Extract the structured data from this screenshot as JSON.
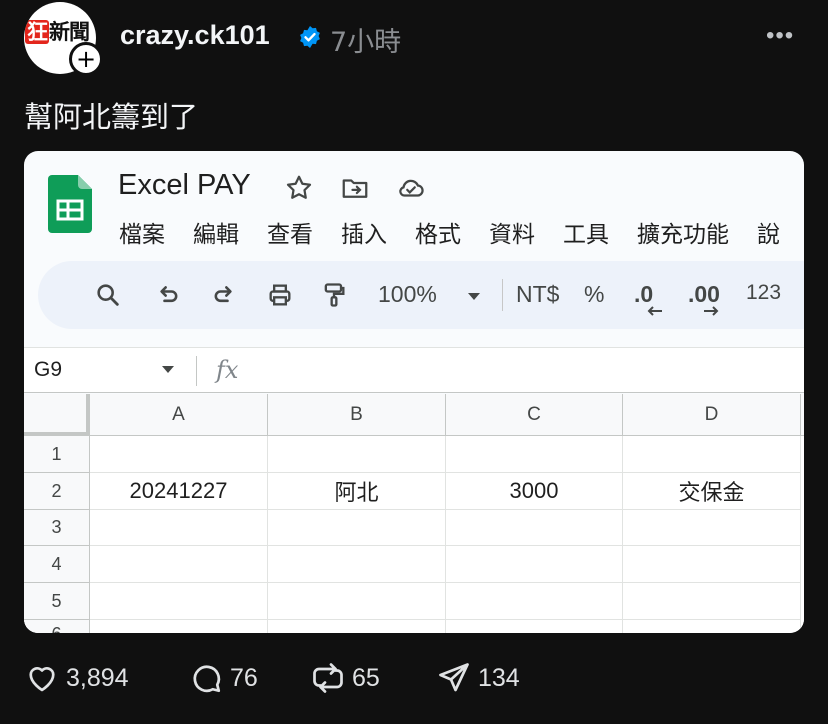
{
  "post": {
    "avatar_text_a": "狂",
    "avatar_text_b": "新聞",
    "username": "crazy.ck101",
    "time": "7小時",
    "more": "•••",
    "text": "幫阿北籌到了"
  },
  "sheet": {
    "title": "Excel PAY",
    "menu": [
      "檔案",
      "編輯",
      "查看",
      "插入",
      "格式",
      "資料",
      "工具",
      "擴充功能",
      "說"
    ],
    "toolbar": {
      "zoom": "100%",
      "currency": "NT$",
      "percent": "%",
      "dec_decrease": ".0",
      "dec_increase": ".00",
      "format": "123"
    },
    "name_box": "G9",
    "fx": "fx",
    "columns": [
      "A",
      "B",
      "C",
      "D"
    ],
    "rows": [
      "1",
      "2",
      "3",
      "4",
      "5",
      "6"
    ],
    "cells": {
      "A2": "20241227",
      "B2": "阿北",
      "C2": "3000",
      "D2": "交保金"
    }
  },
  "actions": {
    "likes": "3,894",
    "comments": "76",
    "reposts": "65",
    "shares": "134"
  },
  "colors": {
    "background": "#101010",
    "verified": "#0095f6",
    "sheets_green": "#0f9d58"
  }
}
